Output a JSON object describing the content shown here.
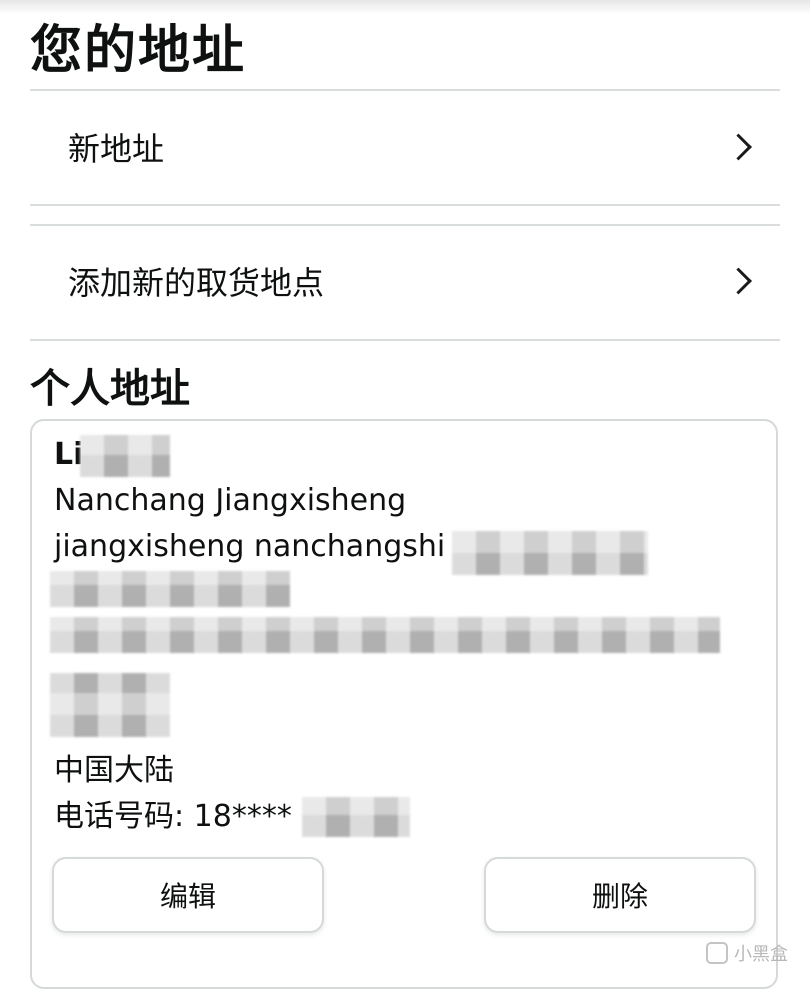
{
  "header": {
    "title": "您的地址"
  },
  "nav": {
    "new_address": "新地址",
    "new_pickup": "添加新的取货地点"
  },
  "section": {
    "personal_addresses": "个人地址"
  },
  "address_card": {
    "name": "Li",
    "city_line": "Nanchang Jiangxisheng",
    "district_line": "jiangxisheng nanchangshi",
    "country": "中国大陆",
    "phone": "电话号码: 18****",
    "edit_label": "编辑",
    "delete_label": "删除"
  },
  "watermark": {
    "text": "小黑盒"
  }
}
